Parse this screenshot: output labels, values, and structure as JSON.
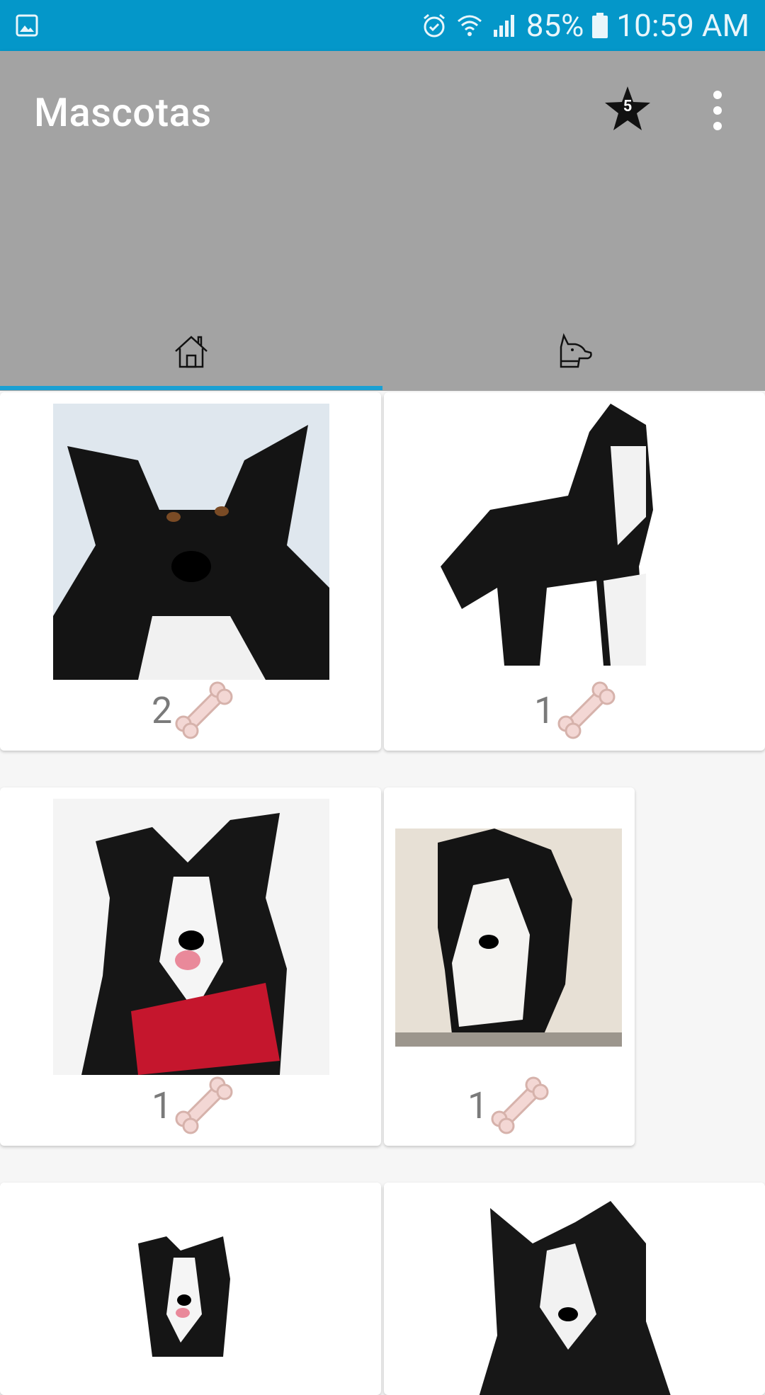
{
  "status_bar": {
    "battery_pct": "85%",
    "time": "10:59 AM",
    "icons": [
      "image-icon",
      "alarm-icon",
      "wifi-icon",
      "signal-icon",
      "battery-icon"
    ]
  },
  "app_bar": {
    "title": "Mascotas",
    "favorites_count": "5",
    "icons": [
      "star-badge-icon",
      "overflow-menu-icon"
    ]
  },
  "tabs": [
    {
      "name": "home",
      "icon": "house-icon",
      "selected": true
    },
    {
      "name": "dog",
      "icon": "dog-head-icon",
      "selected": false
    }
  ],
  "pets": [
    {
      "likes": "2"
    },
    {
      "likes": "1"
    },
    {
      "likes": "1"
    },
    {
      "likes": "1"
    },
    {
      "likes": ""
    },
    {
      "likes": ""
    }
  ],
  "colors": {
    "status_bar": "#0497c9",
    "app_bar": "#a3a3a3",
    "tab_indicator": "#1aa0d3",
    "bone": "#f3d7d4"
  }
}
